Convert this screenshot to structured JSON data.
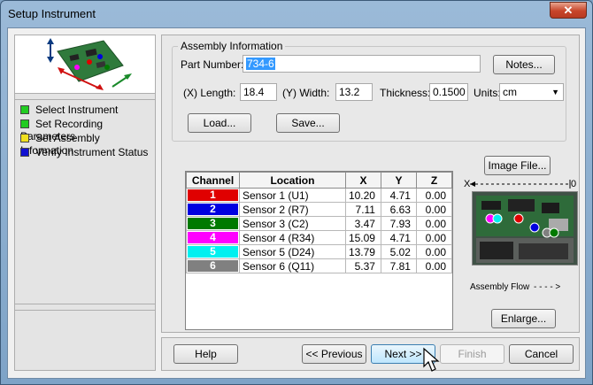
{
  "window": {
    "title": "Setup Instrument",
    "close_glyph": "✕"
  },
  "steps": [
    {
      "label": "Select Instrument",
      "color": "#22cc22"
    },
    {
      "label": "Set Recording Parameters",
      "color": "#22cc22"
    },
    {
      "label": "Set Assembly Information",
      "color": "#f0e020"
    },
    {
      "label": "Verify Instrument Status",
      "color": "#1010d0"
    }
  ],
  "assembly": {
    "legend": "Assembly Information",
    "part_number_label": "Part Number:",
    "part_number_value": "734-6",
    "notes_label": "Notes...",
    "length_label": "(X) Length:",
    "length_value": "18.4",
    "width_label": "(Y) Width:",
    "width_value": "13.2",
    "thickness_label": "Thickness:",
    "thickness_value": "0.1500",
    "units_label": "Units:",
    "units_value": "cm",
    "load_label": "Load...",
    "save_label": "Save..."
  },
  "image_panel": {
    "image_file_label": "Image File...",
    "axis_x": "X",
    "axis_zero": "0",
    "flow_label": "Assembly Flow",
    "flow_arrow": "- - - - >",
    "enlarge_label": "Enlarge..."
  },
  "table": {
    "headers": [
      "Channel",
      "Location",
      "X",
      "Y",
      "Z"
    ],
    "rows": [
      {
        "ch": "1",
        "color": "#e00000",
        "location": "Sensor 1 (U1)",
        "x": "10.20",
        "y": "4.71",
        "z": "0.00"
      },
      {
        "ch": "2",
        "color": "#0000e0",
        "location": "Sensor 2 (R7)",
        "x": "7.11",
        "y": "6.63",
        "z": "0.00"
      },
      {
        "ch": "3",
        "color": "#007a00",
        "location": "Sensor 3 (C2)",
        "x": "3.47",
        "y": "7.93",
        "z": "0.00"
      },
      {
        "ch": "4",
        "color": "#ff00ff",
        "location": "Sensor 4 (R34)",
        "x": "15.09",
        "y": "4.71",
        "z": "0.00"
      },
      {
        "ch": "5",
        "color": "#00f0f0",
        "location": "Sensor 5 (D24)",
        "x": "13.79",
        "y": "5.02",
        "z": "0.00"
      },
      {
        "ch": "6",
        "color": "#808080",
        "location": "Sensor 6 (Q11)",
        "x": "5.37",
        "y": "7.81",
        "z": "0.00"
      }
    ]
  },
  "footer": {
    "help_label": "Help",
    "previous_label": "<< Previous",
    "next_label": "Next >>",
    "finish_label": "Finish",
    "cancel_label": "Cancel"
  }
}
